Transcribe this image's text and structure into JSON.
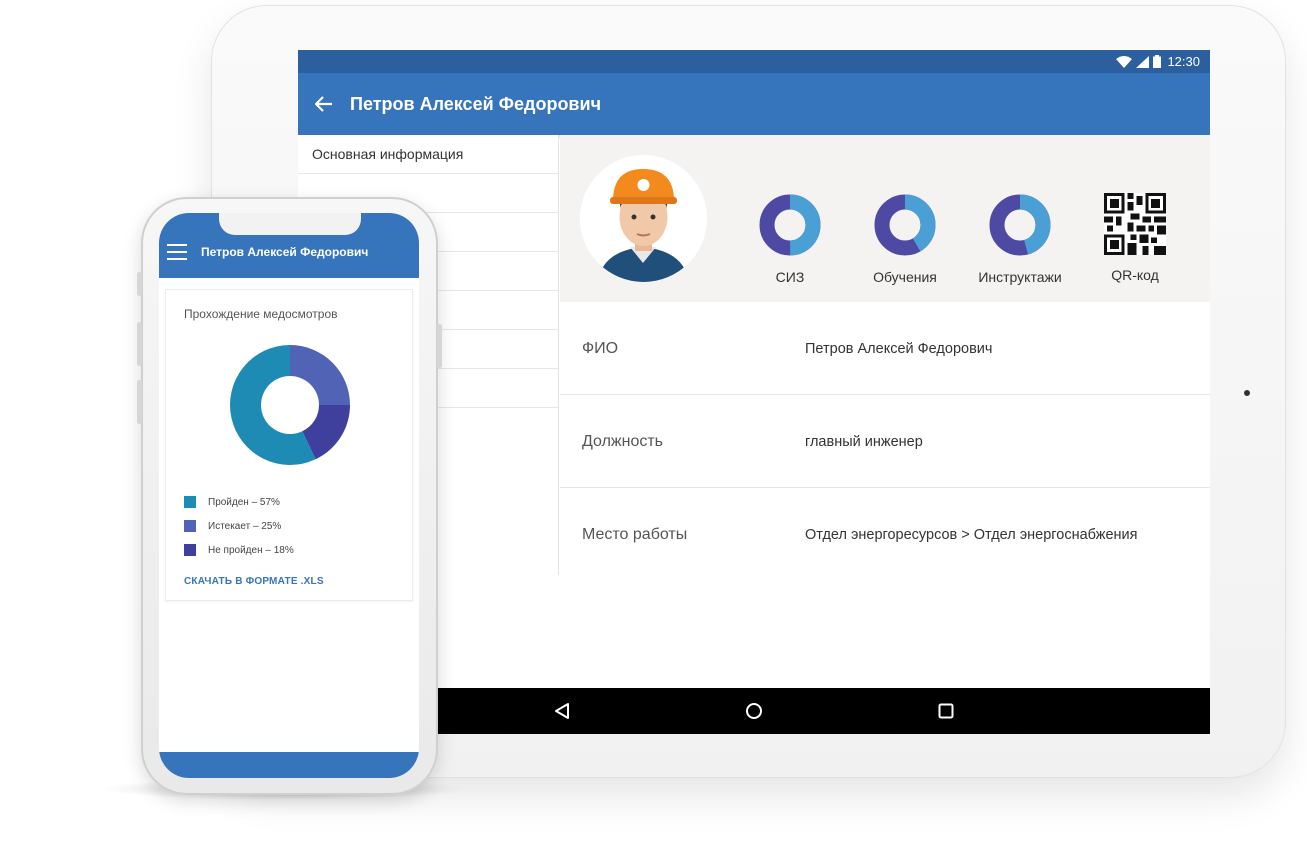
{
  "tablet": {
    "status_bar": {
      "time": "12:30",
      "icons": [
        "wifi-icon",
        "signal-icon",
        "battery-icon"
      ]
    },
    "app_bar": {
      "title": "Петров Алексей Федорович",
      "back_icon": "arrow-left-icon"
    },
    "sidebar": {
      "items": [
        {
          "label": "Основная информация"
        },
        {
          "label": ""
        },
        {
          "label": ""
        },
        {
          "label": ""
        },
        {
          "label": ""
        },
        {
          "label": ""
        },
        {
          "label": ""
        }
      ]
    },
    "profile": {
      "avatar_icon": "worker-avatar-icon",
      "stats": [
        {
          "label": "СИЗ"
        },
        {
          "label": "Обучения"
        },
        {
          "label": "Инструктажи"
        },
        {
          "label": "QR-код"
        }
      ]
    },
    "details": [
      {
        "label": "ФИО",
        "value": "Петров Алексей Федорович"
      },
      {
        "label": "Должность",
        "value": "главный инженер"
      },
      {
        "label": "Место работы",
        "value": "Отдел энергоресурсов > Отдел энергоснабжения"
      }
    ],
    "nav_bar": {
      "icons": [
        "back-triangle-icon",
        "home-circle-icon",
        "recents-square-icon"
      ]
    }
  },
  "phone": {
    "app_bar": {
      "title": "Петров Алексей Федорович",
      "menu_icon": "hamburger-icon"
    },
    "card": {
      "title": "Прохождение медосмотров",
      "legend": [
        {
          "label": "Пройден – 57%",
          "color": "#1e8bb5"
        },
        {
          "label": "Истекает – 25%",
          "color": "#5063b5"
        },
        {
          "label": "Не пройден – 18%",
          "color": "#3f3f9e"
        }
      ],
      "download_label": "СКАЧАТЬ В ФОРМАТЕ .XLS"
    }
  },
  "chart_data": [
    {
      "type": "pie",
      "title": "Прохождение медосмотров",
      "categories": [
        "Пройден",
        "Истекает",
        "Не пройден"
      ],
      "values": [
        57,
        25,
        18
      ],
      "colors": [
        "#1e8bb5",
        "#5063b5",
        "#3f3f9e"
      ],
      "legend": "bottom"
    }
  ],
  "colors": {
    "primary": "#3674bb",
    "status_bar": "#2b5f9e",
    "donut_light": "#4a9fd4",
    "donut_dark": "#4e4aa3"
  }
}
